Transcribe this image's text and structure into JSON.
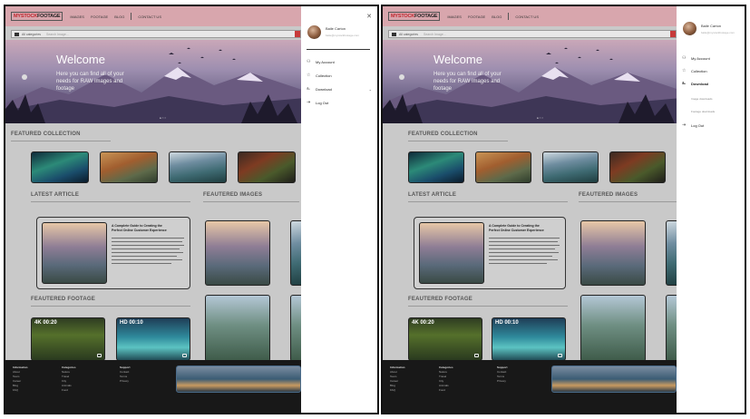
{
  "site": {
    "logo_a": "MY",
    "logo_b": "STOCK",
    "logo_c": "FOOTAGE",
    "nav": [
      "IMAGES",
      "FOOTAGE",
      "BLOG",
      "CONTACT US"
    ],
    "search_scope": "All categories",
    "search_placeholder": "Search Image..."
  },
  "hero": {
    "title": "Welcome",
    "subtitle": "Here you can find all of your needs for RAW images and footage",
    "indicator": "● ○ ○"
  },
  "sections": {
    "featured_collection": "FEATURED COLLECTION",
    "latest_article": "LATEST ARTICLE",
    "featured_images": "FEAUTERED IMAGES",
    "featured_footage": "FEAUTERED FOOTAGE"
  },
  "article": {
    "title_line1": "A Complete Guide to Creating the",
    "title_line2": "Perfect Online Customer Experience"
  },
  "footage": [
    {
      "label": "4K 00:20"
    },
    {
      "label": "HD 00:10"
    }
  ],
  "footer": {
    "col1": {
      "heading": "Information",
      "items": [
        "About",
        "Team",
        "Career",
        "Blog",
        "FAQ"
      ]
    },
    "col2": {
      "heading": "Categories",
      "items": [
        "Nature",
        "Travel",
        "City",
        "Animals",
        "Food"
      ]
    },
    "col3": {
      "heading": "Support",
      "items": [
        "Contact",
        "Terms",
        "Privacy"
      ]
    }
  },
  "drawer": {
    "user_name": "Baile Carton",
    "user_email": "baile@mystockfootage.com",
    "close": "✕",
    "left_menu": [
      {
        "icon": "user-icon",
        "label": "My Account"
      },
      {
        "icon": "star-icon",
        "label": "Collection"
      },
      {
        "icon": "download-icon",
        "label": "Download",
        "expandable": true
      },
      {
        "icon": "logout-icon",
        "label": "Log Out"
      }
    ],
    "right_menu": [
      {
        "icon": "user-icon",
        "label": "My Account"
      },
      {
        "icon": "star-icon",
        "label": "Collection"
      },
      {
        "icon": "download-icon",
        "label": "Download",
        "expanded": true
      },
      {
        "icon": "logout-icon",
        "label": "Log Out"
      }
    ],
    "download_sub": [
      "Image downloads",
      "Footage downloads"
    ]
  },
  "colors": {
    "nav_bg": "#d8a6ad",
    "accent_red": "#c0262d",
    "footer_bg": "#181818"
  }
}
